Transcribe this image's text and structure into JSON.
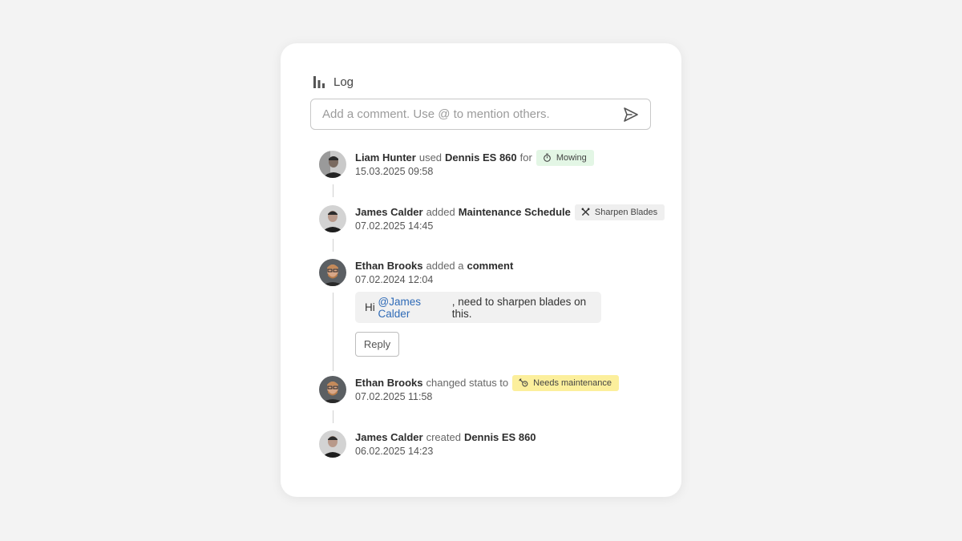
{
  "log": {
    "title": "Log",
    "comment_placeholder": "Add a comment. Use @ to mention others.",
    "entries": [
      {
        "user": "Liam Hunter",
        "action": "used",
        "object": "Dennis ES 860",
        "connector": "for",
        "badge": {
          "label": "Mowing",
          "icon": "timer-icon",
          "color": "#e3f6e5"
        },
        "timestamp": "15.03.2025 09:58"
      },
      {
        "user": "James Calder",
        "action": "added",
        "object": "Maintenance Schedule",
        "badge": {
          "label": "Sharpen Blades",
          "icon": "tools-icon",
          "color": "#efefef"
        },
        "timestamp": "07.02.2025 14:45"
      },
      {
        "user": "Ethan Brooks",
        "action": "added a",
        "object": "comment",
        "timestamp": "07.02.2024 12:04",
        "comment": {
          "prefix": "Hi",
          "mention": "@James Calder",
          "suffix": ", need to sharpen blades on this."
        },
        "reply_label": "Reply"
      },
      {
        "user": "Ethan Brooks",
        "action": "changed status to",
        "badge": {
          "label": "Needs maintenance",
          "icon": "wrench-clock-icon",
          "color": "#fcef9c"
        },
        "timestamp": "07.02.2025 11:58"
      },
      {
        "user": "James Calder",
        "action": "created",
        "object": "Dennis ES 860",
        "timestamp": "06.02.2025 14:23"
      }
    ]
  }
}
